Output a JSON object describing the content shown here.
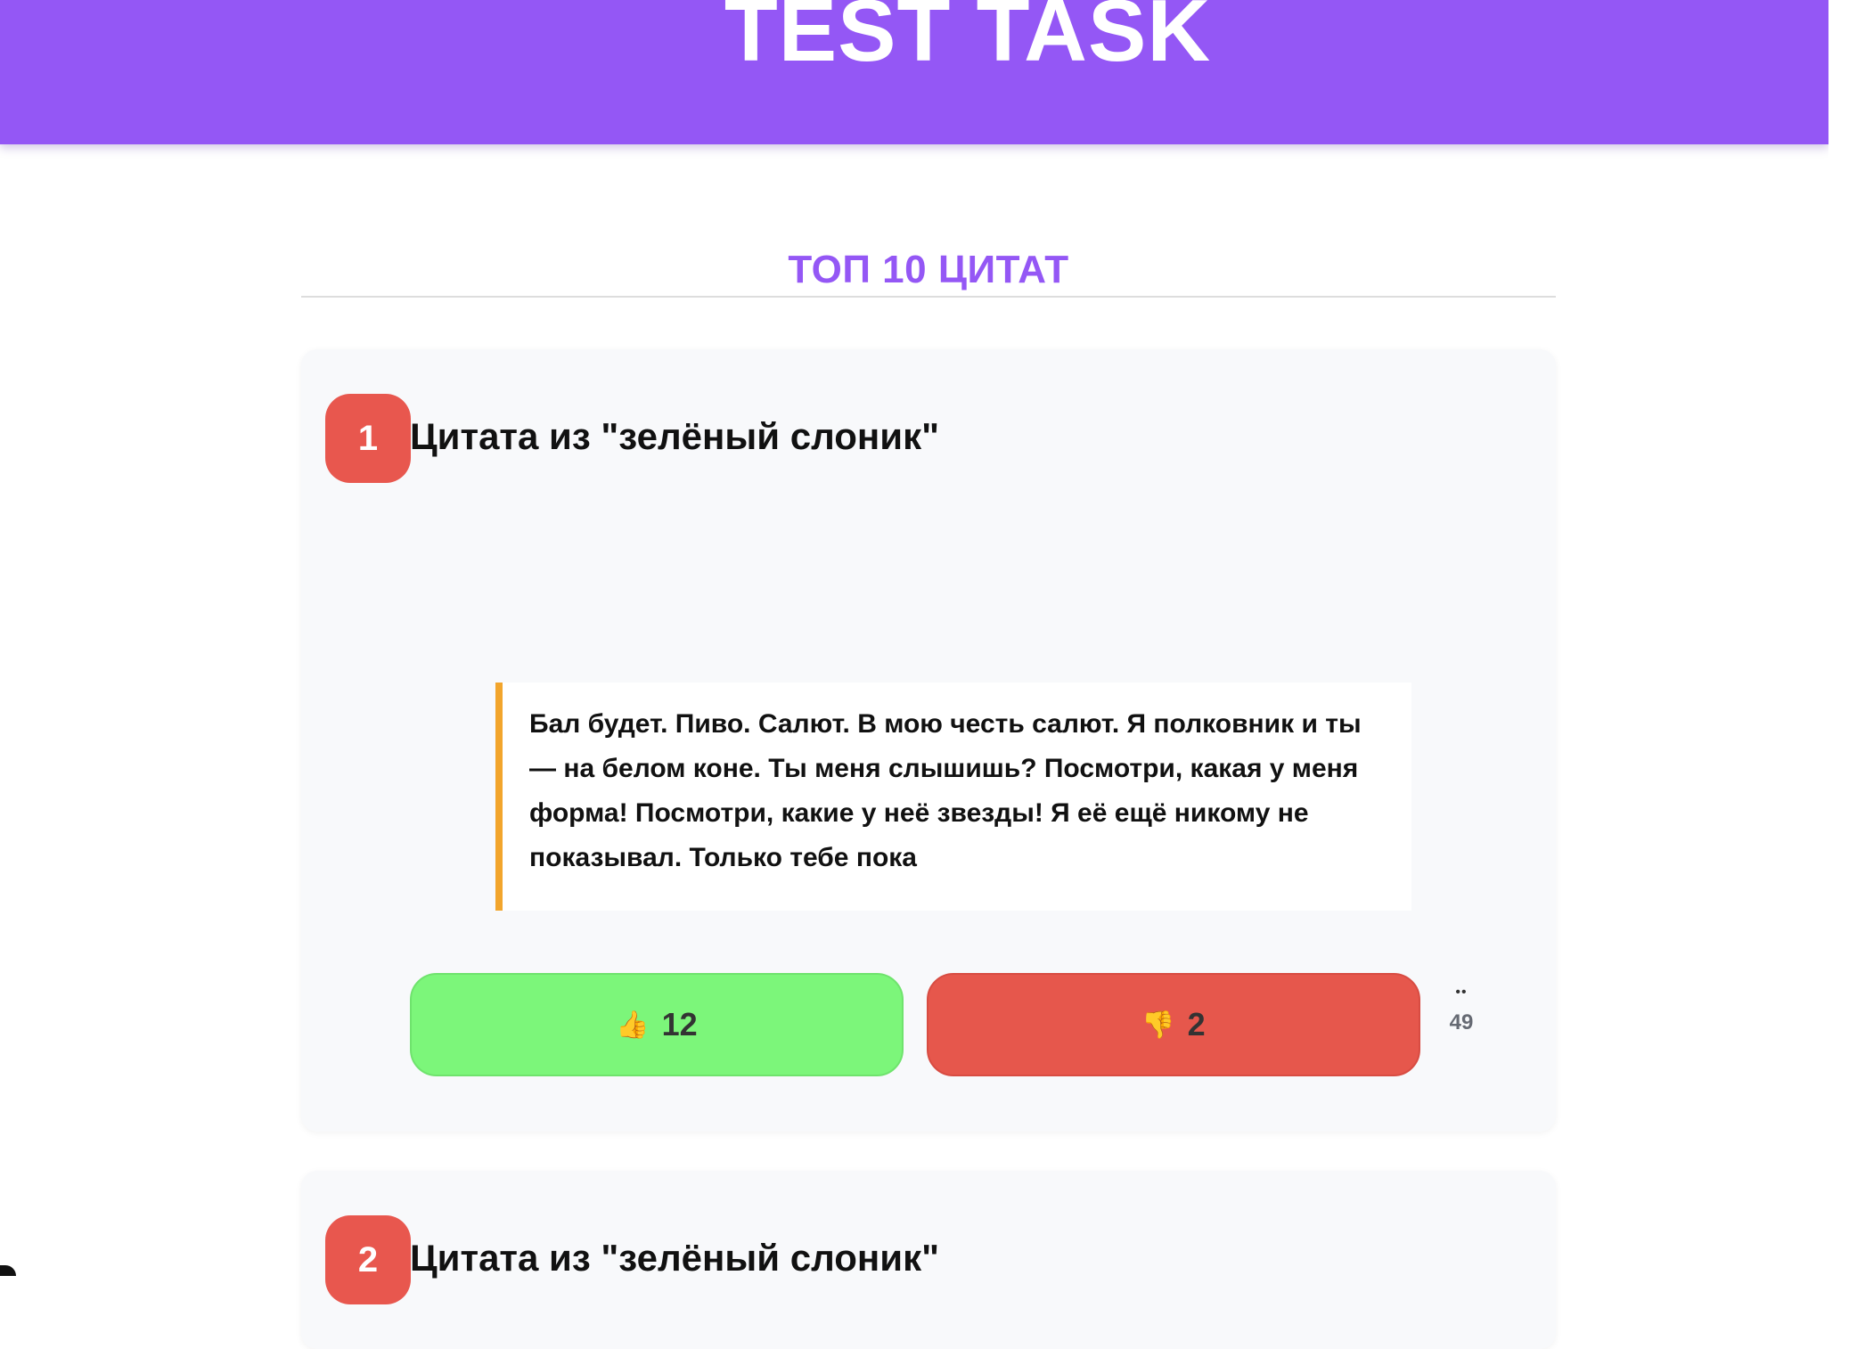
{
  "header": {
    "title": "TEST TASK",
    "background": "#9457f5"
  },
  "section": {
    "title": "ТОП 10 ЦИТАТ",
    "accent": "#9457f5"
  },
  "quotes": [
    {
      "rank": "1",
      "title": "Цитата из \"зелёный слоник\"",
      "text": "Бал будет. Пиво. Салют. В мою честь салют. Я полковник и ты — на белом коне. Ты меня слышишь? Посмотри, какая у меня форма! Посмотри, какие у неё звезды! Я её ещё никому не показывал. Только тебе пока",
      "likes": "12",
      "dislikes": "2",
      "views": "49",
      "like_icon": "👍",
      "dislike_icon": "👎",
      "views_icon": "••"
    },
    {
      "rank": "2",
      "title": "Цитата из \"зелёный слоник\""
    }
  ],
  "colors": {
    "badge": "#e8574e",
    "like": "#7cf67a",
    "dislike": "#e6574c",
    "quote_border": "#f2a52c"
  }
}
